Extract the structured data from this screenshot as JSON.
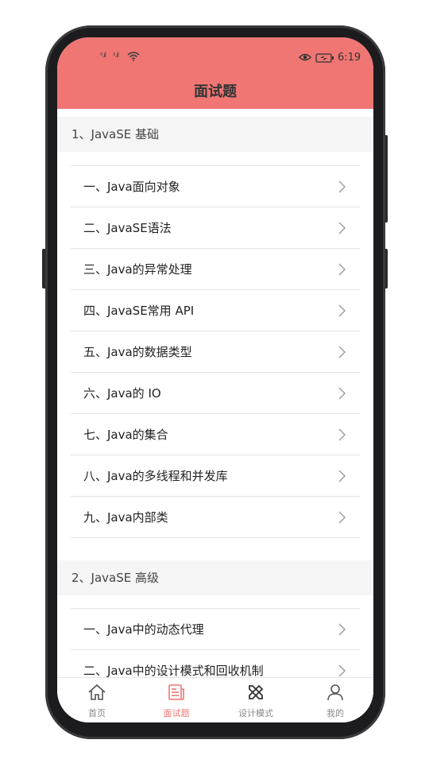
{
  "status_bar": {
    "signal_1": "ᵡ.ıl",
    "signal_2": "ᵡ.ıl",
    "time": "6:19",
    "icons": [
      "signal-icon",
      "signal-icon",
      "wifi-icon",
      "eye-icon",
      "battery-icon"
    ]
  },
  "header": {
    "title": "面试题",
    "background_color": "#f07674"
  },
  "sections": [
    {
      "title": "1、JavaSE 基础",
      "items": [
        "一、Java面向对象",
        "二、JavaSE语法",
        "三、Java的异常处理",
        "四、JavaSE常用 API",
        "五、Java的数据类型",
        "六、Java的 IO",
        "七、Java的集合",
        "八、Java的多线程和并发库",
        "九、Java内部类"
      ]
    },
    {
      "title": "2、JavaSE 高级",
      "items": [
        "一、Java中的动态代理",
        "二、Java中的设计模式和回收机制"
      ]
    }
  ],
  "tabbar": {
    "tabs": [
      {
        "label": "首页",
        "icon": "home-icon",
        "active": false
      },
      {
        "label": "面试题",
        "icon": "document-icon",
        "active": true
      },
      {
        "label": "设计模式",
        "icon": "pencil-ruler-icon",
        "active": false
      },
      {
        "label": "我的",
        "icon": "user-icon",
        "active": false
      }
    ],
    "active_color": "#f07674",
    "inactive_color": "#888888"
  }
}
